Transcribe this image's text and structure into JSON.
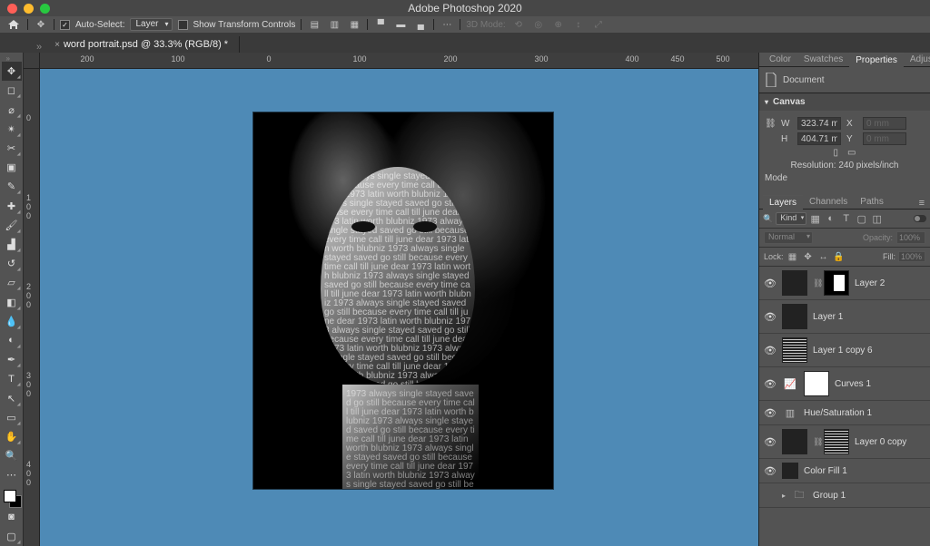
{
  "app": {
    "title": "Adobe Photoshop 2020"
  },
  "options": {
    "auto_select_label": "Auto-Select:",
    "auto_select_checked": true,
    "auto_select_target": "Layer",
    "show_transform_label": "Show Transform Controls",
    "show_transform_checked": false,
    "mode3d_label": "3D Mode:"
  },
  "doc": {
    "tab_title": "word portrait.psd @ 33.3% (RGB/8) *"
  },
  "ruler_h": [
    "",
    "200",
    "100",
    "0",
    "100",
    "200",
    "300",
    "400",
    "450",
    "500"
  ],
  "ruler_h_pos": [
    0,
    70,
    170,
    270,
    370,
    470,
    570,
    670,
    720,
    770
  ],
  "ruler_v": [
    "0",
    "1 0 0",
    "2 0 0",
    "3 0 0",
    "4 0 0"
  ],
  "ruler_v_pos": [
    54,
    152,
    250,
    348,
    446
  ],
  "properties": {
    "tabs": [
      "Color",
      "Swatches",
      "Properties",
      "Adjustments"
    ],
    "active_tab": 2,
    "doc_label": "Document",
    "canvas_label": "Canvas",
    "w_label": "W",
    "w_value": "323.74 mr",
    "x_label": "X",
    "x_value": "0 mm",
    "h_label": "H",
    "h_value": "404.71 mr",
    "y_label": "Y",
    "y_value": "0 mm",
    "resolution": "Resolution: 240 pixels/inch",
    "mode_label": "Mode"
  },
  "layers": {
    "tabs": [
      "Layers",
      "Channels",
      "Paths"
    ],
    "active_tab": 0,
    "kind_label": "Kind",
    "blend_mode": "Normal",
    "opacity_label": "Opacity:",
    "opacity_value": "100%",
    "lock_label": "Lock:",
    "fill_label": "Fill:",
    "fill_value": "100%",
    "items": [
      {
        "name": "Layer 2",
        "type": "layer-with-mask",
        "visible": true,
        "thumb": "bw",
        "mask": true
      },
      {
        "name": "Layer 1",
        "type": "layer",
        "visible": true,
        "thumb": "bw"
      },
      {
        "name": "Layer 1 copy 6",
        "type": "layer",
        "visible": true,
        "thumb": "words"
      },
      {
        "name": "Curves 1",
        "type": "adj-curves",
        "visible": true
      },
      {
        "name": "Hue/Saturation 1",
        "type": "adj-hs",
        "visible": true
      },
      {
        "name": "Layer 0 copy",
        "type": "layer-with-mask",
        "visible": true,
        "thumb": "face",
        "mask": "words"
      },
      {
        "name": "Color Fill 1",
        "type": "adj-solid",
        "visible": true
      },
      {
        "name": "Group 1",
        "type": "group",
        "visible": false
      }
    ]
  },
  "face_text": "1973 always single stayed saved go still because every time call till june dear 1973 latin worth blubniz"
}
